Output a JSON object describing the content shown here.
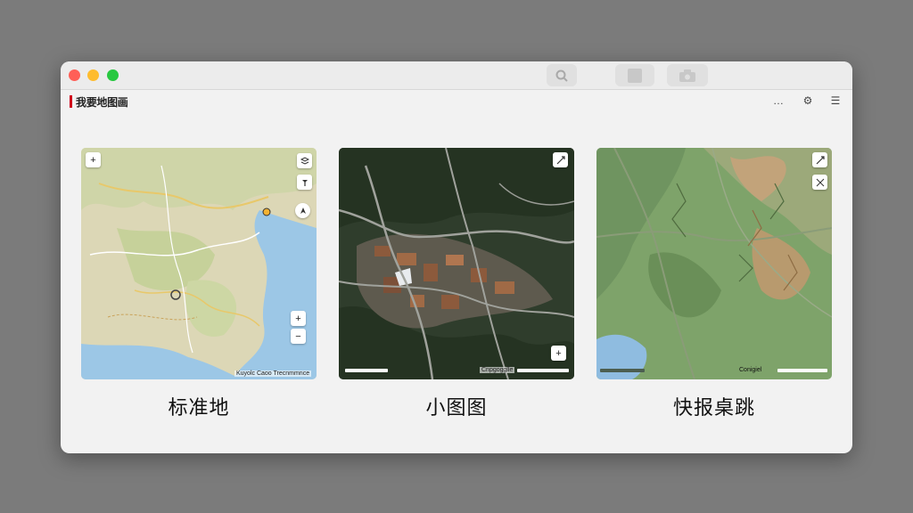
{
  "window": {
    "title": "我要地图画",
    "accent_color": "#d0021b"
  },
  "titlebar": {
    "buttons": [
      "magnifier-icon",
      "square-icon",
      "camera-icon"
    ]
  },
  "toolbar": {
    "more_icon": "…",
    "settings_icon": "⚙",
    "list_icon": "☰"
  },
  "maps": [
    {
      "caption": "标准地",
      "style": "standard",
      "attribution": "Kuyolc Caoo Trecnmmnce",
      "zoom_in": "+",
      "zoom_out": "−"
    },
    {
      "caption": "小图图",
      "style": "satellite",
      "attribution": "Cnpgogglle"
    },
    {
      "caption": "快报桌跳",
      "style": "terrain",
      "attribution": "Conigiel"
    }
  ]
}
